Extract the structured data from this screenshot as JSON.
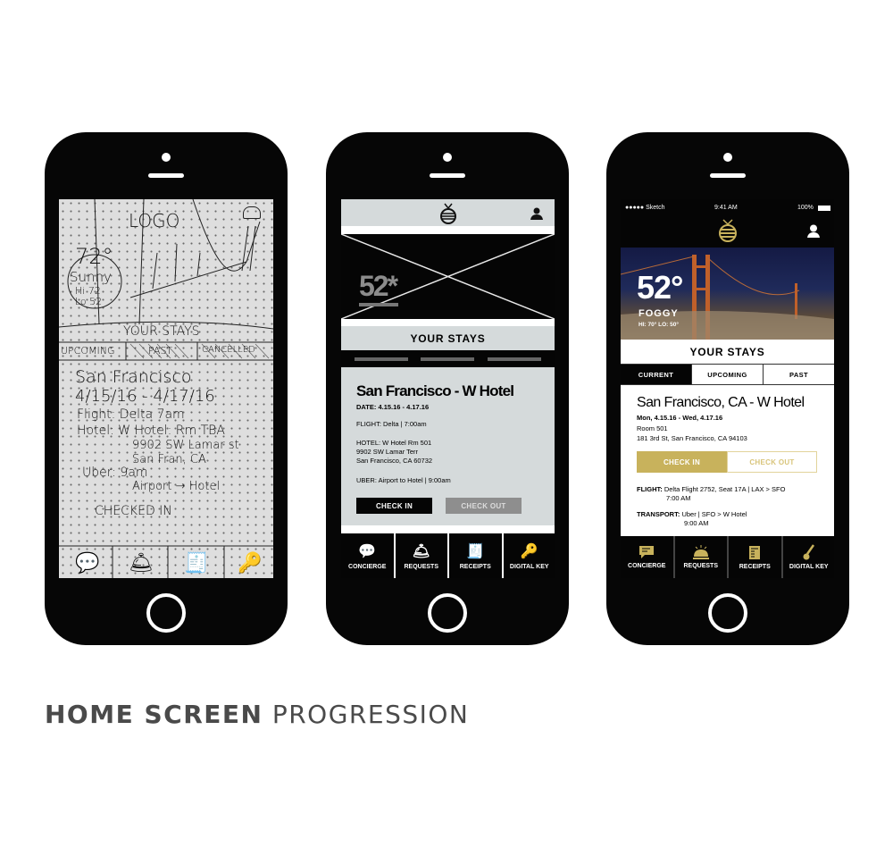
{
  "title": {
    "bold": "HOME SCREEN",
    "regular": "PROGRESSION"
  },
  "colors": {
    "gold": "#c8b25c",
    "black": "#050505",
    "wire_gray": "#d5dadb",
    "text_gray": "#4a4a4a"
  },
  "sketch": {
    "logo": "LOGO",
    "temp": "72°",
    "condition": "Sunny",
    "hi": "Hi 72",
    "lo": "Lo 52",
    "your_stays": "YOUR STAYS",
    "tabs": [
      "UPCOMING",
      "PAST",
      "CANCELLED"
    ],
    "city": "San Francisco",
    "dates": "4/15/16 - 4/17/16",
    "flight": "Flight: Delta 7am",
    "hotel": "Hotel: W Hotel: Rm TBA",
    "hotel_addr1": "9902 SW Lamar st",
    "hotel_addr2": "San Fran, CA",
    "uber": "Uber: 9am",
    "uber_route": "Airport → Hotel",
    "checked_in": "CHECKED IN",
    "nav_icons": [
      "chat-icon",
      "bell-icon",
      "receipt-icon",
      "key-icon"
    ]
  },
  "wireframe": {
    "temp": "52*",
    "your_stays": "YOUR STAYS",
    "stay_title": "San Francisco - W Hotel",
    "date": "DATE: 4.15.16 - 4.17.16",
    "flight": "FLIGHT: Delta | 7:00am",
    "hotel_lines": [
      "HOTEL: W Hotel Rm 501",
      "9902 SW Lamar Terr",
      "San Francisco, CA 60732"
    ],
    "uber": "UBER: Airport to Hotel | 9:00am",
    "check_in": "CHECK IN",
    "check_out": "CHECK OUT",
    "nav": [
      "CONCIERGE",
      "REQUESTS",
      "RECEIPTS",
      "DIGITAL KEY"
    ]
  },
  "final": {
    "status": {
      "carrier": "●●●●● Sketch",
      "time": "9:41 AM",
      "battery": "100%"
    },
    "temp": "52°",
    "condition": "FOGGY",
    "hilo": "HI: 70° LO: 50°",
    "your_stays": "YOUR STAYS",
    "tabs": [
      {
        "label": "CURRENT",
        "active": true
      },
      {
        "label": "UPCOMING",
        "active": false
      },
      {
        "label": "PAST",
        "active": false
      }
    ],
    "stay_title": "San Francisco, CA - W Hotel",
    "dates": "Mon, 4.15.16 - Wed, 4.17.16",
    "room": "Room 501",
    "address": "181 3rd St, San Francisco, CA 94103",
    "check_in": "CHECK IN",
    "check_out": "CHECK OUT",
    "flight_label": "FLIGHT:",
    "flight": "Delta Flight 2752, Seat 17A | LAX > SFO",
    "flight_time": "7:00 AM",
    "transport_label": "TRANSPORT:",
    "transport": "Uber | SFO > W Hotel",
    "transport_time": "9:00 AM",
    "nav": [
      "CONCIERGE",
      "REQUESTS",
      "RECEIPTS",
      "DIGITAL KEY"
    ]
  }
}
